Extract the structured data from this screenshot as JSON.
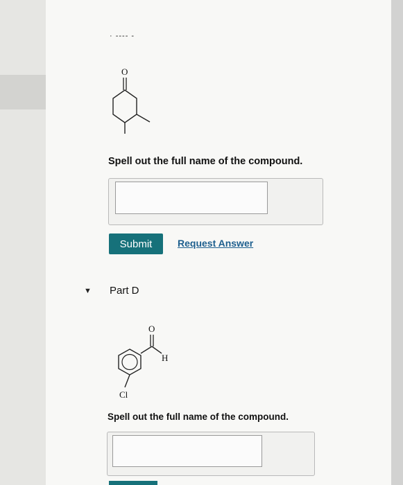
{
  "header": {
    "fragment": "· ---- -"
  },
  "part_c": {
    "structure": {
      "oxygen_label": "O"
    },
    "prompt": "Spell out the full name of the compound.",
    "answer": {
      "value": "",
      "placeholder": ""
    },
    "submit_label": "Submit",
    "request_label": "Request Answer"
  },
  "part_d": {
    "toggle_icon": "triangle-down-icon",
    "title": "Part D",
    "structure": {
      "oxygen_label": "O",
      "hydrogen_label": "H",
      "chlorine_label": "Cl"
    },
    "prompt": "Spell out the full name of the compound.",
    "answer": {
      "value": "",
      "placeholder": ""
    }
  },
  "colors": {
    "accent": "#16717a",
    "link": "#1d5f8e"
  }
}
